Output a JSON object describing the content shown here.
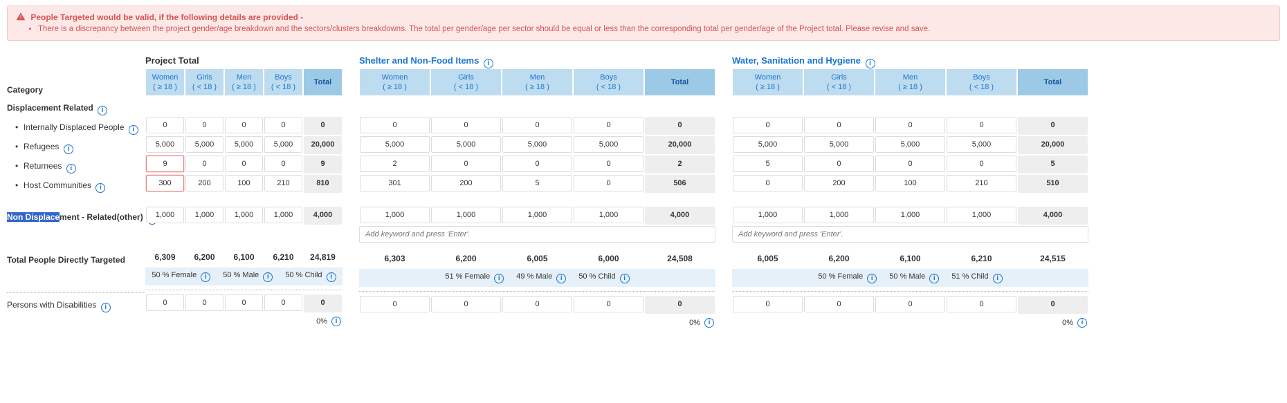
{
  "alert": {
    "title": "People Targeted would be valid, if the following details are provided -",
    "items": [
      "There is a discrepancy between the project gender/age breakdown and the sectors/clusters breakdowns. The total per gender/age per sector should be equal or less than the corresponding total per gender/age of the Project total. Please revise and save."
    ]
  },
  "labels": {
    "category": "Category",
    "displacement_related": "Displacement Related",
    "idp": "Internally Displaced People",
    "refugees": "Refugees",
    "returnees": "Returnees",
    "host": "Host Communities",
    "non_disp_sel": "Non Displace",
    "non_disp_rest": "ment - Related(other)",
    "direct_total": "Total People Directly Targeted",
    "pwd": "Persons with Disabilities"
  },
  "headers": {
    "women": {
      "l1": "Women",
      "l2": "( ≥ 18 )"
    },
    "girls": {
      "l1": "Girls",
      "l2": "( < 18 )"
    },
    "men": {
      "l1": "Men",
      "l2": "( ≥ 18 )"
    },
    "boys": {
      "l1": "Boys",
      "l2": "( < 18 )"
    },
    "total": "Total"
  },
  "sections": {
    "project": {
      "title": "Project Total",
      "rows": {
        "idp": [
          "0",
          "0",
          "0",
          "0",
          "0"
        ],
        "refugees": [
          "5,000",
          "5,000",
          "5,000",
          "5,000",
          "20,000"
        ],
        "returnees": [
          "9",
          "0",
          "0",
          "0",
          "9"
        ],
        "host": [
          "300",
          "200",
          "100",
          "210",
          "810"
        ],
        "nondisp": [
          "1,000",
          "1,000",
          "1,000",
          "1,000",
          "4,000"
        ],
        "direct": [
          "6,309",
          "6,200",
          "6,100",
          "6,210",
          "24,819"
        ],
        "pwd": [
          "0",
          "0",
          "0",
          "0",
          "0"
        ]
      },
      "pct": {
        "female": "50",
        "male": "50",
        "child": "50"
      },
      "zero_pct": "0%"
    },
    "snfi": {
      "title": "Shelter and Non-Food Items",
      "rows": {
        "idp": [
          "0",
          "0",
          "0",
          "0",
          "0"
        ],
        "refugees": [
          "5,000",
          "5,000",
          "5,000",
          "5,000",
          "20,000"
        ],
        "returnees": [
          "2",
          "0",
          "0",
          "0",
          "2"
        ],
        "host": [
          "301",
          "200",
          "5",
          "0",
          "506"
        ],
        "nondisp": [
          "1,000",
          "1,000",
          "1,000",
          "1,000",
          "4,000"
        ],
        "direct": [
          "6,303",
          "6,200",
          "6,005",
          "6,000",
          "24,508"
        ],
        "pwd": [
          "0",
          "0",
          "0",
          "0",
          "0"
        ]
      },
      "pct": {
        "female": "51",
        "male": "49",
        "child": "50"
      },
      "zero_pct": "0%",
      "keyword_ph": "Add keyword and press 'Enter'."
    },
    "wash": {
      "title": "Water, Sanitation and Hygiene",
      "rows": {
        "idp": [
          "0",
          "0",
          "0",
          "0",
          "0"
        ],
        "refugees": [
          "5,000",
          "5,000",
          "5,000",
          "5,000",
          "20,000"
        ],
        "returnees": [
          "5",
          "0",
          "0",
          "0",
          "5"
        ],
        "host": [
          "0",
          "200",
          "100",
          "210",
          "510"
        ],
        "nondisp": [
          "1,000",
          "1,000",
          "1,000",
          "1,000",
          "4,000"
        ],
        "direct": [
          "6,005",
          "6,200",
          "6,100",
          "6,210",
          "24,515"
        ],
        "pwd": [
          "0",
          "0",
          "0",
          "0",
          "0"
        ]
      },
      "pct": {
        "female": "50",
        "male": "50",
        "child": "51"
      },
      "zero_pct": "0%",
      "keyword_ph": "Add keyword and press 'Enter'."
    }
  },
  "pct_labels": {
    "female": "% Female",
    "male": "% Male",
    "child": "% Child"
  }
}
